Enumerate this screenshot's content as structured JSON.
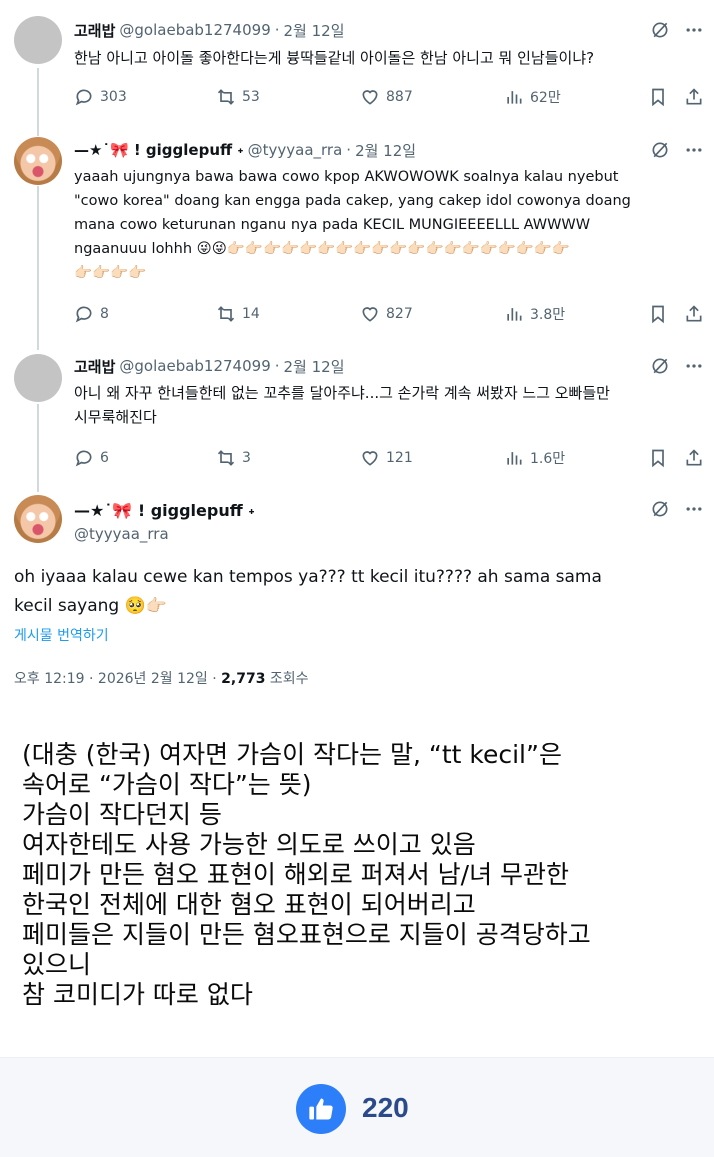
{
  "tweets": [
    {
      "name": "고래밥",
      "handle": "@golaebab1274099",
      "sep": "·",
      "date": "2월 12일",
      "lines": [
        "한남 아니고 아이돌 좋아한다는게 븅딱들같네 아이돌은 한남 아니고 뭐 인남들이냐?"
      ],
      "replies": "303",
      "reposts": "53",
      "likes": "887",
      "views": "62만"
    },
    {
      "name": "—★˙🎀 ! gigglepuff ˖",
      "handle": "@tyyyaa_rra",
      "sep": "·",
      "date": "2월 12일",
      "lines": [
        "yaaah ujungnya bawa bawa cowo kpop AKWOWOWK soalnya kalau nyebut",
        "\"cowo korea\" doang kan engga pada cakep, yang cakep idol cowonya doang",
        "mana cowo keturunan nganu nya pada KECIL MUNGIEEEELLL AWWWW",
        "ngaanuuu lohhh 😜😜👉🏻👉🏻👉🏻👉🏻👉🏻👉🏻👉🏻👉🏻👉🏻👉🏻👉🏻👉🏻👉🏻👉🏻👉🏻👉🏻👉🏻👉🏻👉🏻"
      ],
      "emoji_line": "👉🏻👉🏻👉🏻👉🏻",
      "replies": "8",
      "reposts": "14",
      "likes": "827",
      "views": "3.8만"
    },
    {
      "name": "고래밥",
      "handle": "@golaebab1274099",
      "sep": "·",
      "date": "2월 12일",
      "lines": [
        "아니 왜 자꾸 한녀들한테 없는 꼬추를 달아주냐...그 손가락 계속 써봤자 느그 오빠들만",
        "시무룩해진다"
      ],
      "replies": "6",
      "reposts": "3",
      "likes": "121",
      "views": "1.6만"
    }
  ],
  "main_tweet": {
    "name": "—★˙🎀 ! gigglepuff ˖",
    "handle": "@tyyyaa_rra",
    "lines": [
      "oh iyaaa kalau cewe kan tempos ya??? tt kecil itu???? ah sama sama",
      "kecil sayang 🥺👉🏻"
    ],
    "translate": "게시물 번역하기",
    "time": "오후 12:19 · 2026년 2월 12일 · ",
    "views_num": "2,773",
    "views_label": " 조회수"
  },
  "caption": [
    "(대충 (한국) 여자면 가슴이 작다는 말, “tt kecil”은",
    "속어로 “가슴이 작다”는 뜻)",
    "가슴이 작다던지 등",
    "여자한테도 사용 가능한 의도로 쓰이고 있음",
    "페미가 만든 혐오 표현이 해외로 퍼져서 남/녀 무관한",
    "한국인 전체에 대한 혐오 표현이 되어버리고",
    "페미들은 지들이 만든 혐오표현으로 지들이 공격당하고",
    "있으니",
    "참 코미디가 따로 없다"
  ],
  "like_count": "220",
  "colors": {
    "accent": "#1d9bf0",
    "muted": "#536471",
    "like_blue": "#2d7ff9"
  }
}
